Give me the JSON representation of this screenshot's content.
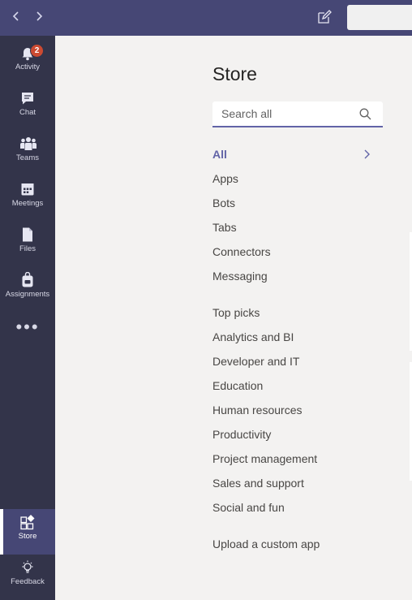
{
  "topbar": {
    "back_icon": "chevron-left-icon",
    "forward_icon": "chevron-right-icon",
    "compose_icon": "compose-icon"
  },
  "rail": {
    "items": [
      {
        "label": "Activity",
        "icon": "bell-icon",
        "badge": "2"
      },
      {
        "label": "Chat",
        "icon": "chat-icon"
      },
      {
        "label": "Teams",
        "icon": "teams-icon"
      },
      {
        "label": "Meetings",
        "icon": "calendar-icon"
      },
      {
        "label": "Files",
        "icon": "file-icon"
      },
      {
        "label": "Assignments",
        "icon": "backpack-icon"
      }
    ],
    "more_label": "•••",
    "store": {
      "label": "Store",
      "icon": "store-icon"
    },
    "feedback": {
      "label": "Feedback",
      "icon": "lightbulb-icon"
    }
  },
  "store": {
    "title": "Store",
    "search_placeholder": "Search all",
    "categories": [
      "All",
      "Apps",
      "Bots",
      "Tabs",
      "Connectors",
      "Messaging"
    ],
    "topics": [
      "Top picks",
      "Analytics and BI",
      "Developer and IT",
      "Education",
      "Human resources",
      "Productivity",
      "Project management",
      "Sales and support",
      "Social and fun"
    ],
    "upload_label": "Upload a custom app"
  },
  "colors": {
    "topbar": "#464775",
    "rail": "#33344a",
    "accent": "#6264a7",
    "badge": "#cc4a31",
    "background": "#f3f2f1"
  }
}
